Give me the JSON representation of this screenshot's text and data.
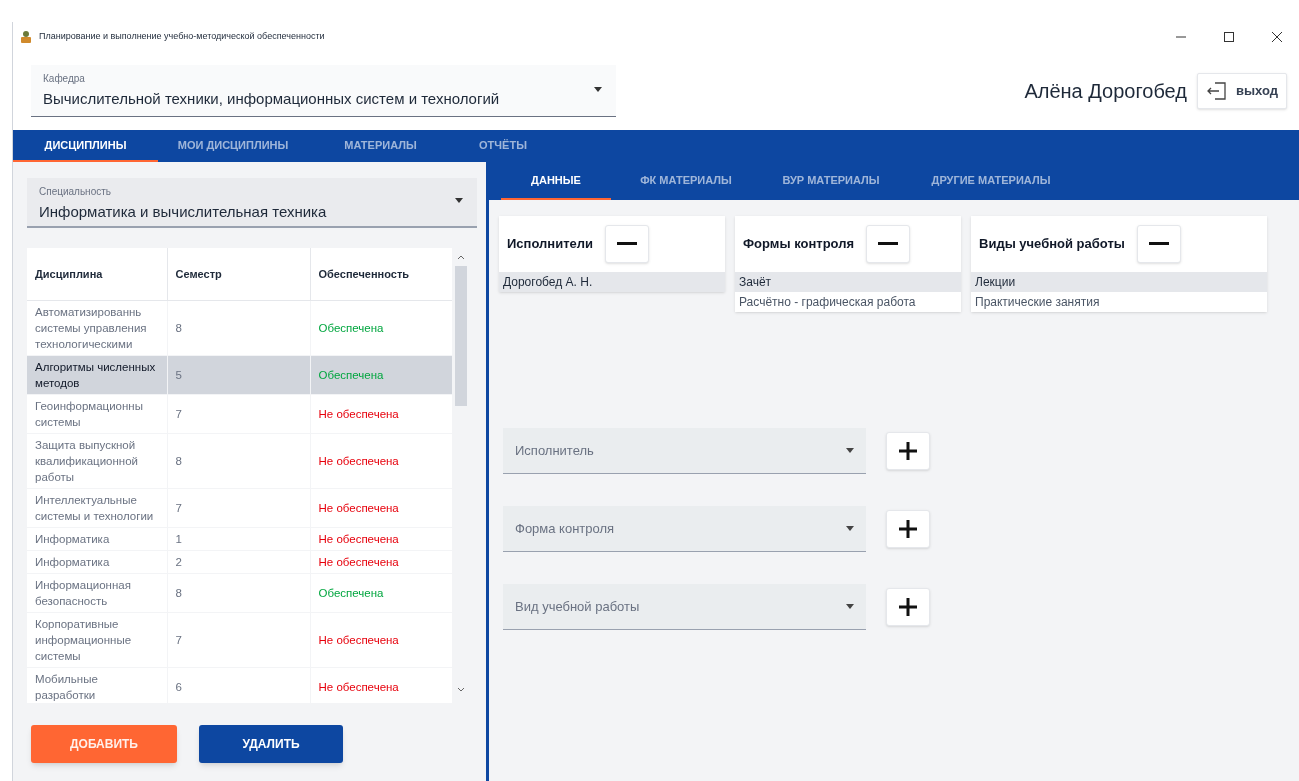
{
  "window": {
    "title": "Планирование и выполнение учебно-методической обеспеченности"
  },
  "department": {
    "label": "Кафедра",
    "value": "Вычислительной техники, информационных систем и технологий"
  },
  "user": {
    "name": "Алёна Дорогобед",
    "logout": "выход"
  },
  "tabs": [
    {
      "label": "ДИСЦИПЛИНЫ",
      "selected": true
    },
    {
      "label": "МОИ ДИСЦИПЛИНЫ",
      "selected": false
    },
    {
      "label": "МАТЕРИАЛЫ",
      "selected": false
    },
    {
      "label": "ОТЧЁТЫ",
      "selected": false
    }
  ],
  "specialty": {
    "label": "Специальность",
    "value": "Информатика и вычислительная техника"
  },
  "table": {
    "columns": [
      "Дисциплина",
      "Семестр",
      "Обеспеченность"
    ],
    "rows": [
      {
        "discipline": "Автоматизированнь системы управления технологическими",
        "semester": "8",
        "status": "Обеспечена",
        "provided": true,
        "selected": false
      },
      {
        "discipline": "Алгоритмы численных методов",
        "semester": "5",
        "status": "Обеспечена",
        "provided": true,
        "selected": true
      },
      {
        "discipline": "Геоинформационны системы",
        "semester": "7",
        "status": "Не обеспечена",
        "provided": false,
        "selected": false
      },
      {
        "discipline": "Защита выпускной квалификационной работы",
        "semester": "8",
        "status": "Не обеспечена",
        "provided": false,
        "selected": false
      },
      {
        "discipline": "Интеллектуальные системы и технологии",
        "semester": "7",
        "status": "Не обеспечена",
        "provided": false,
        "selected": false
      },
      {
        "discipline": "Информатика",
        "semester": "1",
        "status": "Не обеспечена",
        "provided": false,
        "selected": false
      },
      {
        "discipline": "Информатика",
        "semester": "2",
        "status": "Не обеспечена",
        "provided": false,
        "selected": false
      },
      {
        "discipline": "Информационная безопасность",
        "semester": "8",
        "status": "Обеспечена",
        "provided": true,
        "selected": false
      },
      {
        "discipline": "Корпоративные информационные системы",
        "semester": "7",
        "status": "Не обеспечена",
        "provided": false,
        "selected": false
      },
      {
        "discipline": "Мобильные разработки",
        "semester": "6",
        "status": "Не обеспечена",
        "provided": false,
        "selected": false
      }
    ]
  },
  "buttons": {
    "add": "ДОБАВИТЬ",
    "delete": "УДАЛИТЬ"
  },
  "subtabs": [
    {
      "label": "ДАННЫЕ",
      "selected": true
    },
    {
      "label": "ФК МАТЕРИАЛЫ",
      "selected": false
    },
    {
      "label": "ВУР МАТЕРИАЛЫ",
      "selected": false
    },
    {
      "label": "ДРУГИЕ МАТЕРИАЛЫ",
      "selected": false
    }
  ],
  "lists": [
    {
      "title": "Исполнители",
      "items": [
        {
          "text": "Дорогобед А. Н.",
          "selected": true
        }
      ]
    },
    {
      "title": "Формы контроля",
      "items": [
        {
          "text": "Зачёт",
          "selected": true
        },
        {
          "text": "Расчётно - графическая работа",
          "selected": false
        }
      ]
    },
    {
      "title": "Виды учебной работы",
      "items": [
        {
          "text": "Лекции",
          "selected": true
        },
        {
          "text": "Практические занятия",
          "selected": false
        }
      ]
    }
  ],
  "pickers": [
    {
      "placeholder": "Исполнитель"
    },
    {
      "placeholder": "Форма контроля"
    },
    {
      "placeholder": "Вид учебной работы"
    }
  ]
}
